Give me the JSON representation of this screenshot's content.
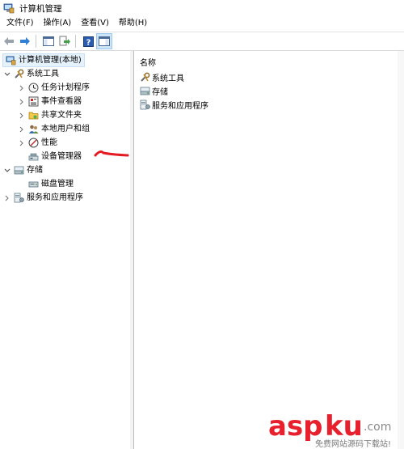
{
  "window": {
    "title": "计算机管理"
  },
  "menu": [
    {
      "label": "文件(F)"
    },
    {
      "label": "操作(A)"
    },
    {
      "label": "查看(V)"
    },
    {
      "label": "帮助(H)"
    }
  ],
  "toolbar": {
    "icons": [
      "back-arrow-icon",
      "forward-arrow-icon",
      "console-tree-icon",
      "export-list-icon",
      "help-icon",
      "show-hide-pane-icon"
    ]
  },
  "tree": {
    "root": {
      "label": "计算机管理(本地)",
      "icon": "computer-management-icon"
    },
    "system_tools": {
      "label": "系统工具",
      "icon": "tools-icon",
      "children": [
        {
          "label": "任务计划程序",
          "icon": "clock-icon"
        },
        {
          "label": "事件查看器",
          "icon": "event-viewer-icon"
        },
        {
          "label": "共享文件夹",
          "icon": "shared-folder-icon"
        },
        {
          "label": "本地用户和组",
          "icon": "users-icon"
        },
        {
          "label": "性能",
          "icon": "performance-icon"
        },
        {
          "label": "设备管理器",
          "icon": "device-manager-icon"
        }
      ]
    },
    "storage": {
      "label": "存储",
      "icon": "storage-icon",
      "children": [
        {
          "label": "磁盘管理",
          "icon": "disk-icon"
        }
      ]
    },
    "services": {
      "label": "服务和应用程序",
      "icon": "services-icon"
    }
  },
  "list": {
    "header": "名称",
    "items": [
      {
        "label": "系统工具",
        "icon": "tools-icon"
      },
      {
        "label": "存储",
        "icon": "storage-icon"
      },
      {
        "label": "服务和应用程序",
        "icon": "services-icon"
      }
    ]
  },
  "watermark": {
    "brand": "aspku",
    "suffix": ".com",
    "sub": "免费网站源码下载站!"
  },
  "colors": {
    "accent": "#e81f2c",
    "selection": "#e5f1fb",
    "arrow": "#e41b23"
  }
}
